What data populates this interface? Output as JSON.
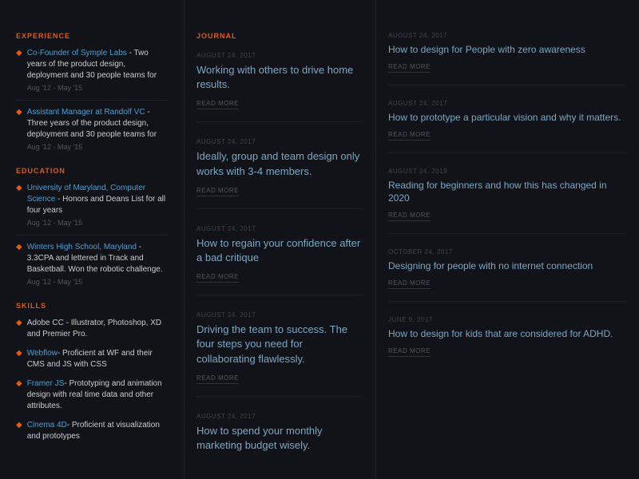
{
  "sidebar": {
    "experience": {
      "section_title": "EXPERIENCE",
      "entries": [
        {
          "title_prefix": "Co-Founder of Symple Labs",
          "title_suffix": " - Two years of the product design, deployment and 30 people teams for",
          "date": "Aug '12 - May '15"
        },
        {
          "title_prefix": "Assistant Manager at Randolf VC",
          "title_suffix": " - Three years of the product design, deployment and 30 people teams for",
          "date": "Aug '12 - May '15"
        }
      ]
    },
    "education": {
      "section_title": "EDUCATION",
      "entries": [
        {
          "title_prefix": "University of Maryland, Computer Science",
          "title_suffix": "- Honors and Deans List for all four years",
          "date": "Aug '12 - May '15"
        },
        {
          "title_prefix": "Winters High School, Maryland",
          "title_suffix": "- 3.3CPA and lettered in Track and Basketball. Won the robotic challenge.",
          "date": "Aug '12 - May '15"
        }
      ]
    },
    "skills": {
      "section_title": "SKILLS",
      "entries": [
        {
          "text": "Adobe CC - Illustrator, Photoshop, XD and Premier Pro."
        },
        {
          "text": "Webflow- Proficient at WF and their CMS and JS with CSS"
        },
        {
          "text": "Framer JS- Prototyping and animation design with real time data and other attributes."
        },
        {
          "text": "Cinema 4D- Proficient at visualization and prototypes"
        }
      ]
    }
  },
  "journal": {
    "section_title": "JOURNAL",
    "entries": [
      {
        "date": "AUGUST 24, 2017",
        "title": "Working with others to drive home results.",
        "read_more": "READ MORE"
      },
      {
        "date": "AUGUST 24, 2017",
        "title": "Ideally, group and team design only works with 3-4 members.",
        "read_more": "READ MORE"
      },
      {
        "date": "AUGUST 24, 2017",
        "title": "How to regain your confidence after a bad critique",
        "read_more": "READ MORE"
      },
      {
        "date": "AUGUST 24, 2017",
        "title": "Driving the team to success. The four steps you need for collaborating flawlessly.",
        "read_more": "READ MORE"
      },
      {
        "date": "AUGUST 24, 2017",
        "title": "How to spend your monthly marketing budget wisely.",
        "read_more": "READ MORE"
      }
    ]
  },
  "right": {
    "entries": [
      {
        "date": "AUGUST 24, 2017",
        "title": "How to design for People with zero awareness",
        "read_more": "Read More"
      },
      {
        "date": "AUGUST 24, 2017",
        "title": "How to prototype a particular vision and why it matters.",
        "read_more": "Read More"
      },
      {
        "date": "AUGUST 24, 2019",
        "title": "Reading for beginners and how this has changed in 2020",
        "read_more": "Read More"
      },
      {
        "date": "OCTOBER 24, 2017",
        "title": "Designing for people with no internet connection",
        "read_more": "Read More"
      },
      {
        "date": "JUNE 9, 2017",
        "title": "How to design for kids that are considered for ADHD.",
        "read_more": "Read More"
      }
    ]
  }
}
